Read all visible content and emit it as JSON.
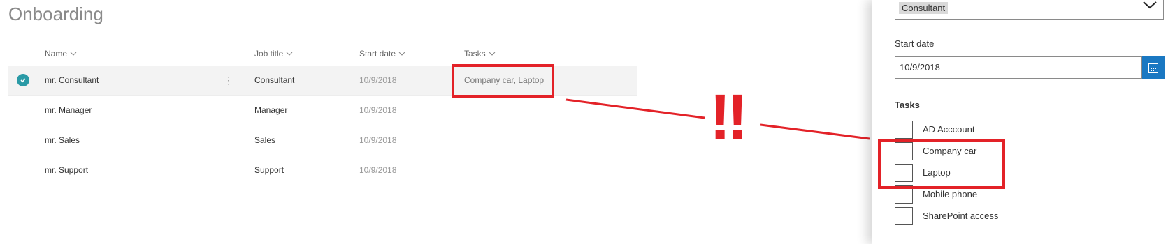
{
  "list": {
    "title": "Onboarding",
    "columns": [
      "Name",
      "Job title",
      "Start date",
      "Tasks"
    ],
    "rows": [
      {
        "name": "mr. Consultant",
        "job": "Consultant",
        "date": "10/9/2018",
        "tasks": "Company car, Laptop",
        "selected": true
      },
      {
        "name": "mr. Manager",
        "job": "Manager",
        "date": "10/9/2018",
        "tasks": ""
      },
      {
        "name": "mr. Sales",
        "job": "Sales",
        "date": "10/9/2018",
        "tasks": ""
      },
      {
        "name": "mr. Support",
        "job": "Support",
        "date": "10/9/2018",
        "tasks": ""
      }
    ],
    "more_glyph": "⋮"
  },
  "annotation": {
    "text": "!!",
    "color": "#e32228"
  },
  "panel": {
    "job_title_value": "Consultant",
    "start_date_label": "Start date",
    "start_date_value": "10/9/2018",
    "tasks_label": "Tasks",
    "tasks": [
      {
        "label": "AD Acccount",
        "checked": false
      },
      {
        "label": "Company car",
        "checked": false
      },
      {
        "label": "Laptop",
        "checked": false
      },
      {
        "label": "Mobile phone",
        "checked": false
      },
      {
        "label": "SharePoint access",
        "checked": false
      }
    ]
  },
  "colors": {
    "accent": "#1a78c2",
    "check": "#2a9aa6",
    "highlight": "#e32228"
  }
}
